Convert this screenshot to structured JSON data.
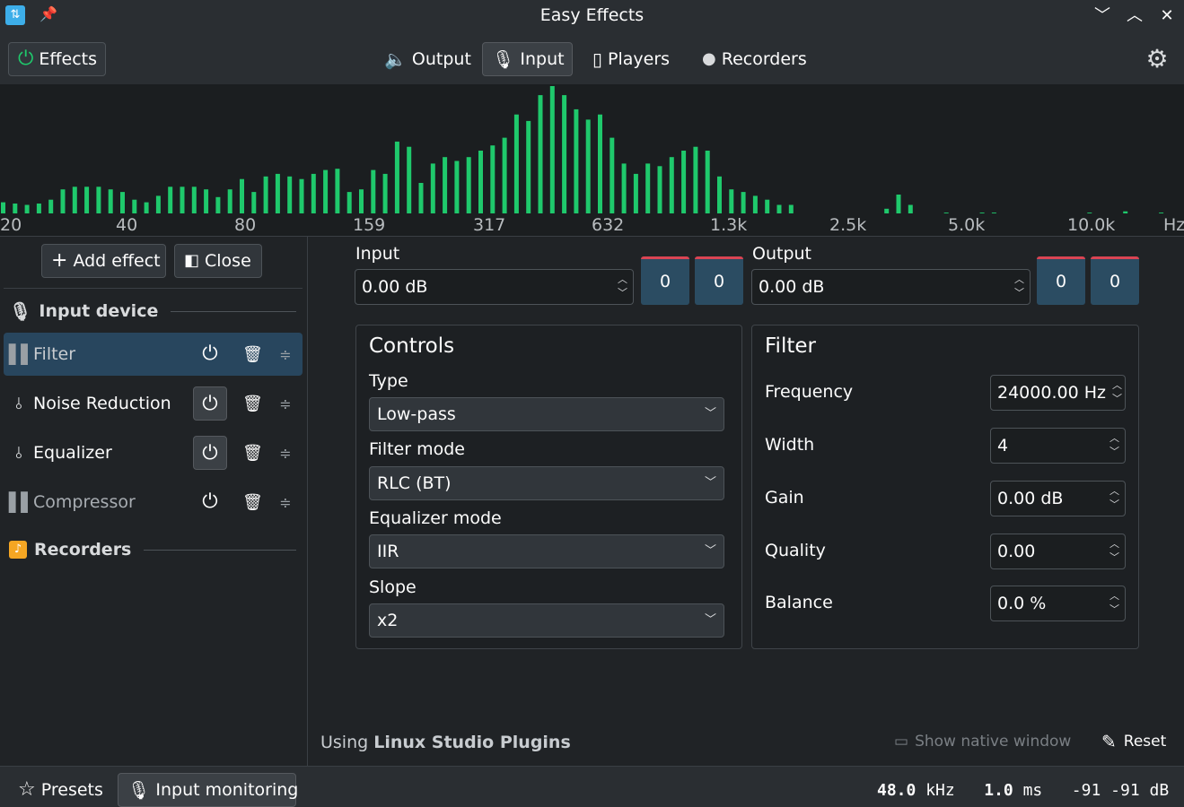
{
  "window": {
    "title": "Easy Effects",
    "minimize_glyph": "﹀",
    "maximize_glyph": "︿",
    "close_glyph": "✕"
  },
  "toolbar": {
    "effects_label": "Effects",
    "tabs": [
      {
        "label": "Output",
        "icon": "speaker-icon"
      },
      {
        "label": "Input",
        "icon": "microphone-icon",
        "active": true
      },
      {
        "label": "Players",
        "icon": "device-icon"
      },
      {
        "label": "Recorders",
        "icon": "record-dot-icon"
      }
    ]
  },
  "spectrum": {
    "color": "#1fc96c",
    "freq_labels": [
      "20",
      "40",
      "80",
      "159",
      "317",
      "632",
      "1.3k",
      "2.5k",
      "5.0k",
      "10.0k",
      "Hz"
    ],
    "levels": [
      0.1,
      0.09,
      0.08,
      0.09,
      0.12,
      0.2,
      0.22,
      0.22,
      0.22,
      0.2,
      0.18,
      0.12,
      0.1,
      0.15,
      0.22,
      0.22,
      0.22,
      0.2,
      0.14,
      0.2,
      0.28,
      0.18,
      0.3,
      0.32,
      0.3,
      0.28,
      0.32,
      0.35,
      0.36,
      0.18,
      0.2,
      0.35,
      0.32,
      0.57,
      0.53,
      0.25,
      0.4,
      0.45,
      0.42,
      0.45,
      0.5,
      0.54,
      0.6,
      0.78,
      0.73,
      0.93,
      1.0,
      0.93,
      0.82,
      0.74,
      0.78,
      0.6,
      0.4,
      0.32,
      0.4,
      0.38,
      0.45,
      0.5,
      0.53,
      0.5,
      0.3,
      0.2,
      0.18,
      0.15,
      0.12,
      0.08,
      0.08,
      0,
      0,
      0,
      0,
      0,
      0,
      0,
      0.05,
      0.16,
      0.08,
      0,
      0,
      0.02,
      0,
      0,
      0.02,
      0.02,
      0,
      0,
      0,
      0,
      0,
      0,
      0,
      0.02,
      0,
      0,
      0.03,
      0,
      0,
      0.02
    ]
  },
  "sidebar": {
    "add_effect_label": "Add effect",
    "close_label": "Close",
    "input_device_header": "Input device",
    "recorders_header": "Recorders",
    "plugins": [
      {
        "name": "Filter",
        "selected": true,
        "bypassed": true,
        "enabled": false
      },
      {
        "name": "Noise Reduction",
        "selected": false,
        "bypassed": false,
        "enabled": true
      },
      {
        "name": "Equalizer",
        "selected": false,
        "bypassed": false,
        "enabled": true
      },
      {
        "name": "Compressor",
        "selected": false,
        "bypassed": true,
        "enabled": false
      }
    ]
  },
  "gain": {
    "input_label": "Input",
    "input_value": "0.00 dB",
    "input_meter_left": "0",
    "input_meter_right": "0",
    "output_label": "Output",
    "output_value": "0.00 dB",
    "output_meter_left": "0",
    "output_meter_right": "0"
  },
  "controls": {
    "title": "Controls",
    "type_label": "Type",
    "type_value": "Low-pass",
    "filter_mode_label": "Filter mode",
    "filter_mode_value": "RLC (BT)",
    "equalizer_mode_label": "Equalizer mode",
    "equalizer_mode_value": "IIR",
    "slope_label": "Slope",
    "slope_value": "x2"
  },
  "filter": {
    "title": "Filter",
    "frequency_label": "Frequency",
    "frequency_value": "24000.00 Hz",
    "width_label": "Width",
    "width_value": "4",
    "gain_label": "Gain",
    "gain_value": "0.00 dB",
    "quality_label": "Quality",
    "quality_value": "0.00",
    "balance_label": "Balance",
    "balance_value": "0.0 %"
  },
  "footer": {
    "using_prefix": "Using",
    "plugin_package": "Linux Studio Plugins",
    "show_native_label": "Show native window",
    "reset_label": "Reset"
  },
  "status": {
    "presets_label": "Presets",
    "monitoring_label": "Input monitoring",
    "sample_rate_value": "48.0",
    "sample_rate_unit": "kHz",
    "latency_value": "1.0",
    "latency_unit": "ms",
    "level_left": "-91",
    "level_right": "-91",
    "level_unit": "dB"
  }
}
